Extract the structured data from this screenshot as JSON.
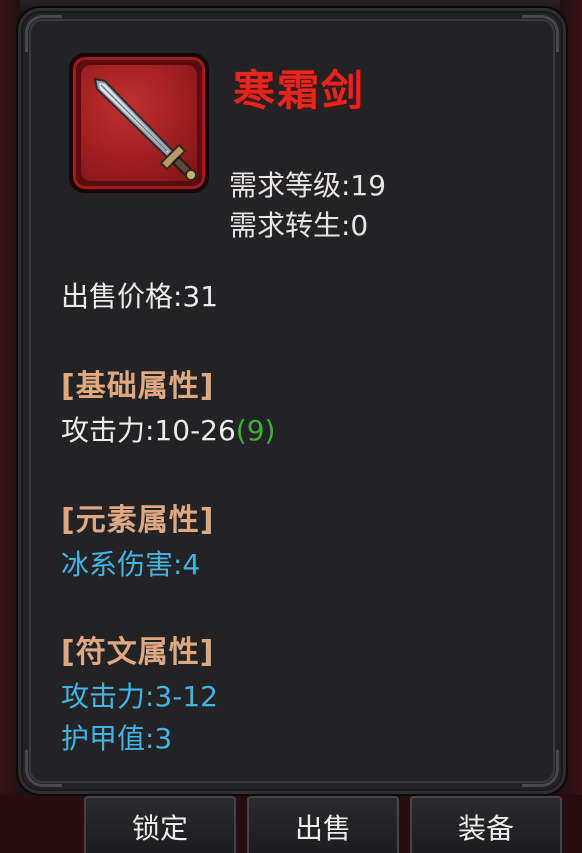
{
  "item": {
    "name": "寒霜剑",
    "icon": "sword-icon",
    "required_level": "需求等级:19",
    "required_rebirth": "需求转生:0",
    "sell_price": "出售价格:31"
  },
  "sections": {
    "base": {
      "header": "[基础属性]",
      "attack_prefix": "攻击力:10-26",
      "attack_bonus": "(9)"
    },
    "element": {
      "header": "[元素属性]",
      "ice_damage": "冰系伤害:4"
    },
    "rune": {
      "header": "[符文属性]",
      "attack": "攻击力:3-12",
      "armor": "护甲值:3"
    }
  },
  "buttons": {
    "lock": "锁定",
    "sell": "出售",
    "equip": "装备"
  },
  "colors": {
    "item_name": "#e4261f",
    "section_header": "#dfa880",
    "rune_stat": "#42b4e4",
    "bonus": "#3fae3b",
    "panel_bg": "#232326"
  }
}
